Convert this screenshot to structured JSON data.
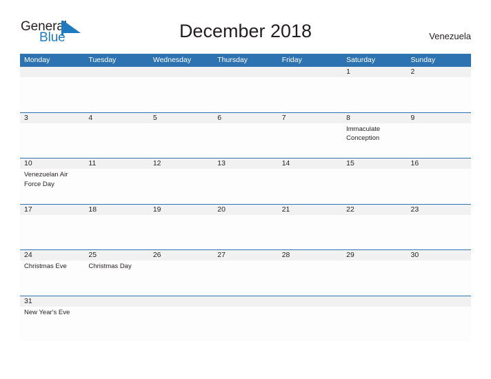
{
  "logo": {
    "word_dark": "General",
    "word_blue": "Blue",
    "flag_icon": "blue-flag-triangle-icon",
    "brand_blue": "#1f7bc1"
  },
  "header": {
    "title": "December 2018",
    "country": "Venezuela"
  },
  "theme": {
    "header_blue": "#2e73b1",
    "row_line_blue": "#2e73b1",
    "date_strip_gray": "#f1f1f1",
    "cell_white": "#fdfdfd",
    "text_dark": "#231f20"
  },
  "calendar": {
    "day_headers": [
      "Monday",
      "Tuesday",
      "Wednesday",
      "Thursday",
      "Friday",
      "Saturday",
      "Sunday"
    ],
    "weeks": [
      {
        "days": [
          {
            "num": "",
            "event": ""
          },
          {
            "num": "",
            "event": ""
          },
          {
            "num": "",
            "event": ""
          },
          {
            "num": "",
            "event": ""
          },
          {
            "num": "",
            "event": ""
          },
          {
            "num": "1",
            "event": ""
          },
          {
            "num": "2",
            "event": ""
          }
        ]
      },
      {
        "days": [
          {
            "num": "3",
            "event": ""
          },
          {
            "num": "4",
            "event": ""
          },
          {
            "num": "5",
            "event": ""
          },
          {
            "num": "6",
            "event": ""
          },
          {
            "num": "7",
            "event": ""
          },
          {
            "num": "8",
            "event": "Immaculate Conception"
          },
          {
            "num": "9",
            "event": ""
          }
        ]
      },
      {
        "days": [
          {
            "num": "10",
            "event": "Venezuelan Air Force Day"
          },
          {
            "num": "11",
            "event": ""
          },
          {
            "num": "12",
            "event": ""
          },
          {
            "num": "13",
            "event": ""
          },
          {
            "num": "14",
            "event": ""
          },
          {
            "num": "15",
            "event": ""
          },
          {
            "num": "16",
            "event": ""
          }
        ]
      },
      {
        "days": [
          {
            "num": "17",
            "event": ""
          },
          {
            "num": "18",
            "event": ""
          },
          {
            "num": "19",
            "event": ""
          },
          {
            "num": "20",
            "event": ""
          },
          {
            "num": "21",
            "event": ""
          },
          {
            "num": "22",
            "event": ""
          },
          {
            "num": "23",
            "event": ""
          }
        ]
      },
      {
        "days": [
          {
            "num": "24",
            "event": "Christmas Eve"
          },
          {
            "num": "25",
            "event": "Christmas Day"
          },
          {
            "num": "26",
            "event": ""
          },
          {
            "num": "27",
            "event": ""
          },
          {
            "num": "28",
            "event": ""
          },
          {
            "num": "29",
            "event": ""
          },
          {
            "num": "30",
            "event": ""
          }
        ]
      },
      {
        "days": [
          {
            "num": "31",
            "event": "New Year's Eve"
          },
          {
            "num": "",
            "event": ""
          },
          {
            "num": "",
            "event": ""
          },
          {
            "num": "",
            "event": ""
          },
          {
            "num": "",
            "event": ""
          },
          {
            "num": "",
            "event": ""
          },
          {
            "num": "",
            "event": ""
          }
        ]
      }
    ]
  }
}
